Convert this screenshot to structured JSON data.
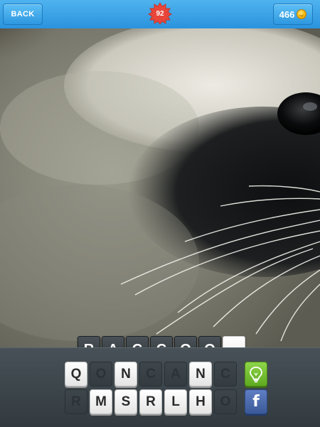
{
  "header": {
    "back_label": "BACK",
    "level": "92",
    "coins": "466",
    "coin_icon": "coin-smile-icon"
  },
  "photo": {
    "subject_icon": "raccoon-closeup-photo"
  },
  "answer": {
    "slots": [
      "R",
      "A",
      "C",
      "C",
      "O",
      "O",
      ""
    ]
  },
  "keyboard": {
    "row1": [
      {
        "letter": "Q",
        "used": false
      },
      {
        "letter": "O",
        "used": true
      },
      {
        "letter": "N",
        "used": false
      },
      {
        "letter": "C",
        "used": true
      },
      {
        "letter": "A",
        "used": true
      },
      {
        "letter": "N",
        "used": false
      },
      {
        "letter": "C",
        "used": true
      }
    ],
    "row2": [
      {
        "letter": "R",
        "used": true
      },
      {
        "letter": "M",
        "used": false
      },
      {
        "letter": "S",
        "used": false
      },
      {
        "letter": "R",
        "used": false
      },
      {
        "letter": "L",
        "used": false
      },
      {
        "letter": "H",
        "used": false
      },
      {
        "letter": "O",
        "used": true
      }
    ],
    "hint_icon": "lightbulb-icon",
    "share_icon": "facebook-icon"
  },
  "colors": {
    "header_blue": "#2a93dd",
    "badge_red": "#e8463a",
    "hint_green": "#6cbb2a",
    "facebook_blue": "#3b5998"
  }
}
